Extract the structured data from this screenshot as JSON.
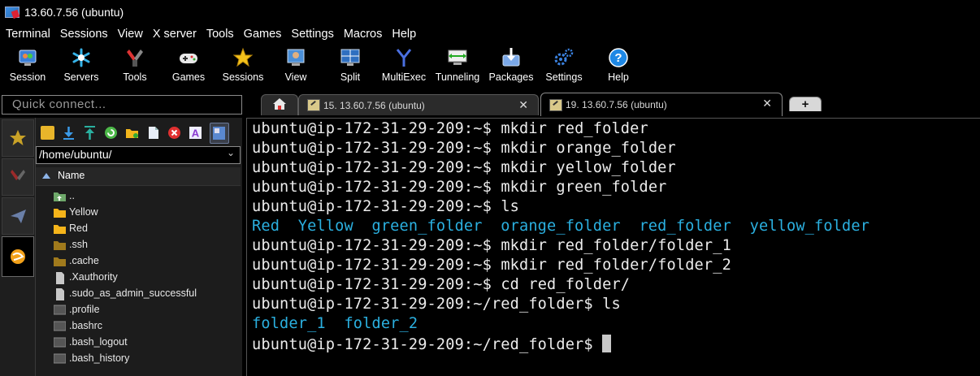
{
  "window": {
    "title": "13.60.7.56 (ubuntu)"
  },
  "menu": [
    "Terminal",
    "Sessions",
    "View",
    "X server",
    "Tools",
    "Games",
    "Settings",
    "Macros",
    "Help"
  ],
  "toolbar": [
    {
      "label": "Session",
      "icon": "session-icon"
    },
    {
      "label": "Servers",
      "icon": "servers-icon"
    },
    {
      "label": "Tools",
      "icon": "tools-icon"
    },
    {
      "label": "Games",
      "icon": "gamepad-icon"
    },
    {
      "label": "Sessions",
      "icon": "star-icon"
    },
    {
      "label": "View",
      "icon": "view-icon"
    },
    {
      "label": "Split",
      "icon": "split-icon"
    },
    {
      "label": "MultiExec",
      "icon": "multiexec-icon"
    },
    {
      "label": "Tunneling",
      "icon": "tunneling-icon"
    },
    {
      "label": "Packages",
      "icon": "packages-icon"
    },
    {
      "label": "Settings",
      "icon": "settings-gears-icon"
    },
    {
      "label": "Help",
      "icon": "help-icon"
    }
  ],
  "quick_connect": {
    "placeholder": "Quick connect..."
  },
  "tabs": [
    {
      "label": "",
      "icon": "home-icon"
    },
    {
      "label": "15. 13.60.7.56 (ubuntu)",
      "close": "✕"
    },
    {
      "label": "19. 13.60.7.56 (ubuntu)",
      "close": "✕",
      "active": true
    },
    {
      "label": "",
      "icon": "new-tab-plus-icon"
    }
  ],
  "file_browser": {
    "path": "/home/ubuntu/",
    "column_header": "Name",
    "entries": [
      {
        "name": "..",
        "type": "parent"
      },
      {
        "name": "Yellow",
        "type": "folder"
      },
      {
        "name": "Red",
        "type": "folder"
      },
      {
        "name": ".ssh",
        "type": "folder-dim"
      },
      {
        "name": ".cache",
        "type": "folder-dim"
      },
      {
        "name": ".Xauthority",
        "type": "file"
      },
      {
        "name": ".sudo_as_admin_successful",
        "type": "file"
      },
      {
        "name": ".profile",
        "type": "file-dark"
      },
      {
        "name": ".bashrc",
        "type": "file-dark"
      },
      {
        "name": ".bash_logout",
        "type": "file-dark"
      },
      {
        "name": ".bash_history",
        "type": "file-dark"
      }
    ]
  },
  "terminal": {
    "lines": [
      {
        "prompt": "ubuntu@ip-172-31-29-209:~$ ",
        "cmd": "mkdir red_folder"
      },
      {
        "prompt": "ubuntu@ip-172-31-29-209:~$ ",
        "cmd": "mkdir orange_folder"
      },
      {
        "prompt": "ubuntu@ip-172-31-29-209:~$ ",
        "cmd": "mkdir yellow_folder"
      },
      {
        "prompt": "ubuntu@ip-172-31-29-209:~$ ",
        "cmd": "mkdir green_folder"
      },
      {
        "prompt": "ubuntu@ip-172-31-29-209:~$ ",
        "cmd": "ls"
      },
      {
        "output": "Red  Yellow  green_folder  orange_folder  red_folder  yellow_folder"
      },
      {
        "prompt": "ubuntu@ip-172-31-29-209:~$ ",
        "cmd": "mkdir red_folder/folder_1"
      },
      {
        "prompt": "ubuntu@ip-172-31-29-209:~$ ",
        "cmd": "mkdir red_folder/folder_2"
      },
      {
        "prompt": "ubuntu@ip-172-31-29-209:~$ ",
        "cmd": "cd red_folder/"
      },
      {
        "prompt": "ubuntu@ip-172-31-29-209:~/red_folder$ ",
        "cmd": "ls"
      },
      {
        "output": "folder_1  folder_2"
      },
      {
        "prompt": "ubuntu@ip-172-31-29-209:~/red_folder$ ",
        "cmd": "",
        "cursor": true
      }
    ]
  },
  "colors": {
    "directory": "#2bb0e0",
    "folder": "#f2b61c",
    "background": "#000000"
  }
}
